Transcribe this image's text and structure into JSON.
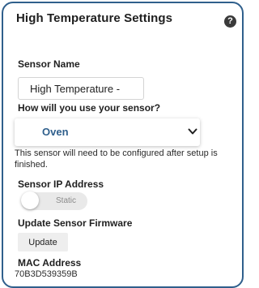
{
  "header": {
    "title": "High Temperature Settings",
    "help_icon": "question-mark-icon",
    "help_glyph": "?"
  },
  "sensor_name": {
    "label": "Sensor Name",
    "value": "High Temperature -"
  },
  "usage": {
    "label": "How will you use your sensor?",
    "selected": "Oven",
    "note": "This sensor will need to be configured after setup is finished."
  },
  "ip": {
    "label": "Sensor IP Address",
    "toggle_label": "Static",
    "toggle_on": false
  },
  "firmware": {
    "label": "Update Sensor Firmware",
    "button_label": "Update"
  },
  "mac": {
    "label": "MAC Address",
    "value": "70B3D539359B"
  },
  "colors": {
    "frame_border": "#2f5f8c",
    "accent": "#2f5f8c",
    "help_bg": "#3a3a3a"
  }
}
